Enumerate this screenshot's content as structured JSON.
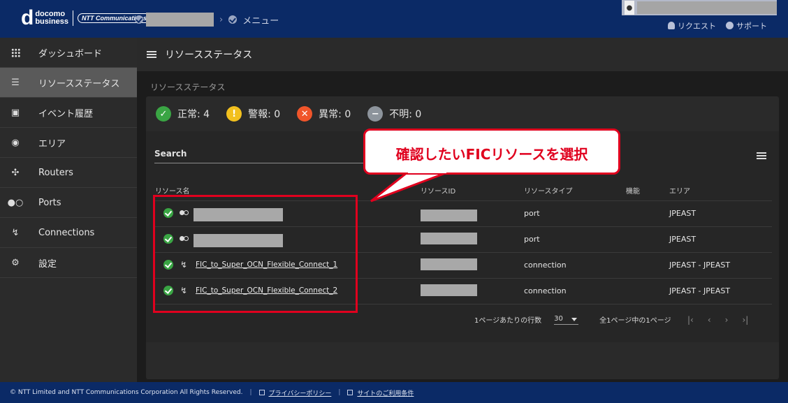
{
  "header": {
    "logo_docomo": "docomo",
    "logo_business": "business",
    "logo_ntt": "NTT Communications",
    "breadcrumb_menu": "メニュー",
    "request_link": "リクエスト",
    "support_link": "サポート"
  },
  "sidebar": {
    "items": [
      {
        "label": "ダッシュボード",
        "icon": "grid-icon"
      },
      {
        "label": "リソースステータス",
        "icon": "status-list-icon"
      },
      {
        "label": "イベント履歴",
        "icon": "calendar-icon"
      },
      {
        "label": "エリア",
        "icon": "globe-icon"
      },
      {
        "label": "Routers",
        "icon": "router-icon"
      },
      {
        "label": "Ports",
        "icon": "port-icon"
      },
      {
        "label": "Connections",
        "icon": "connection-icon"
      },
      {
        "label": "設定",
        "icon": "gear-icon"
      }
    ]
  },
  "main": {
    "header_title": "リソースステータス",
    "section_title": "リソースステータス",
    "status": {
      "normal": "正常: 4",
      "warning": "警報: 0",
      "error": "異常: 0",
      "unknown": "不明: 0"
    },
    "search_label": "Search",
    "table": {
      "headers": [
        "リソース名",
        "リソースID",
        "リソースタイプ",
        "機能",
        "エリア"
      ],
      "rows": [
        {
          "name": "",
          "type": "port",
          "area": "JPEAST"
        },
        {
          "name": "",
          "type": "port",
          "area": "JPEAST"
        },
        {
          "name": "FIC_to_Super_OCN_Flexible_Connect_1",
          "type": "connection",
          "area": "JPEAST - JPEAST"
        },
        {
          "name": "FIC_to_Super_OCN_Flexible_Connect_2",
          "type": "connection",
          "area": "JPEAST - JPEAST"
        }
      ]
    },
    "pagination": {
      "rows_per_page_label": "1ページあたりの行数",
      "rows_per_page": "30",
      "page_info": "全1ページ中の1ページ"
    }
  },
  "callout": {
    "text": "確認したいFICリソースを選択"
  },
  "footer": {
    "copyright": "© NTT Limited and NTT Communications Corporation All Rights Reserved.",
    "privacy": "プライバシーポリシー",
    "terms": "サイトのご利用条件"
  },
  "colors": {
    "header_bg": "#0b2a66",
    "accent_red": "#e0001e",
    "ok_green": "#3aa544",
    "warn_yellow": "#f2c01e",
    "error_orange": "#f0552a",
    "unknown_gray": "#8d949c"
  }
}
